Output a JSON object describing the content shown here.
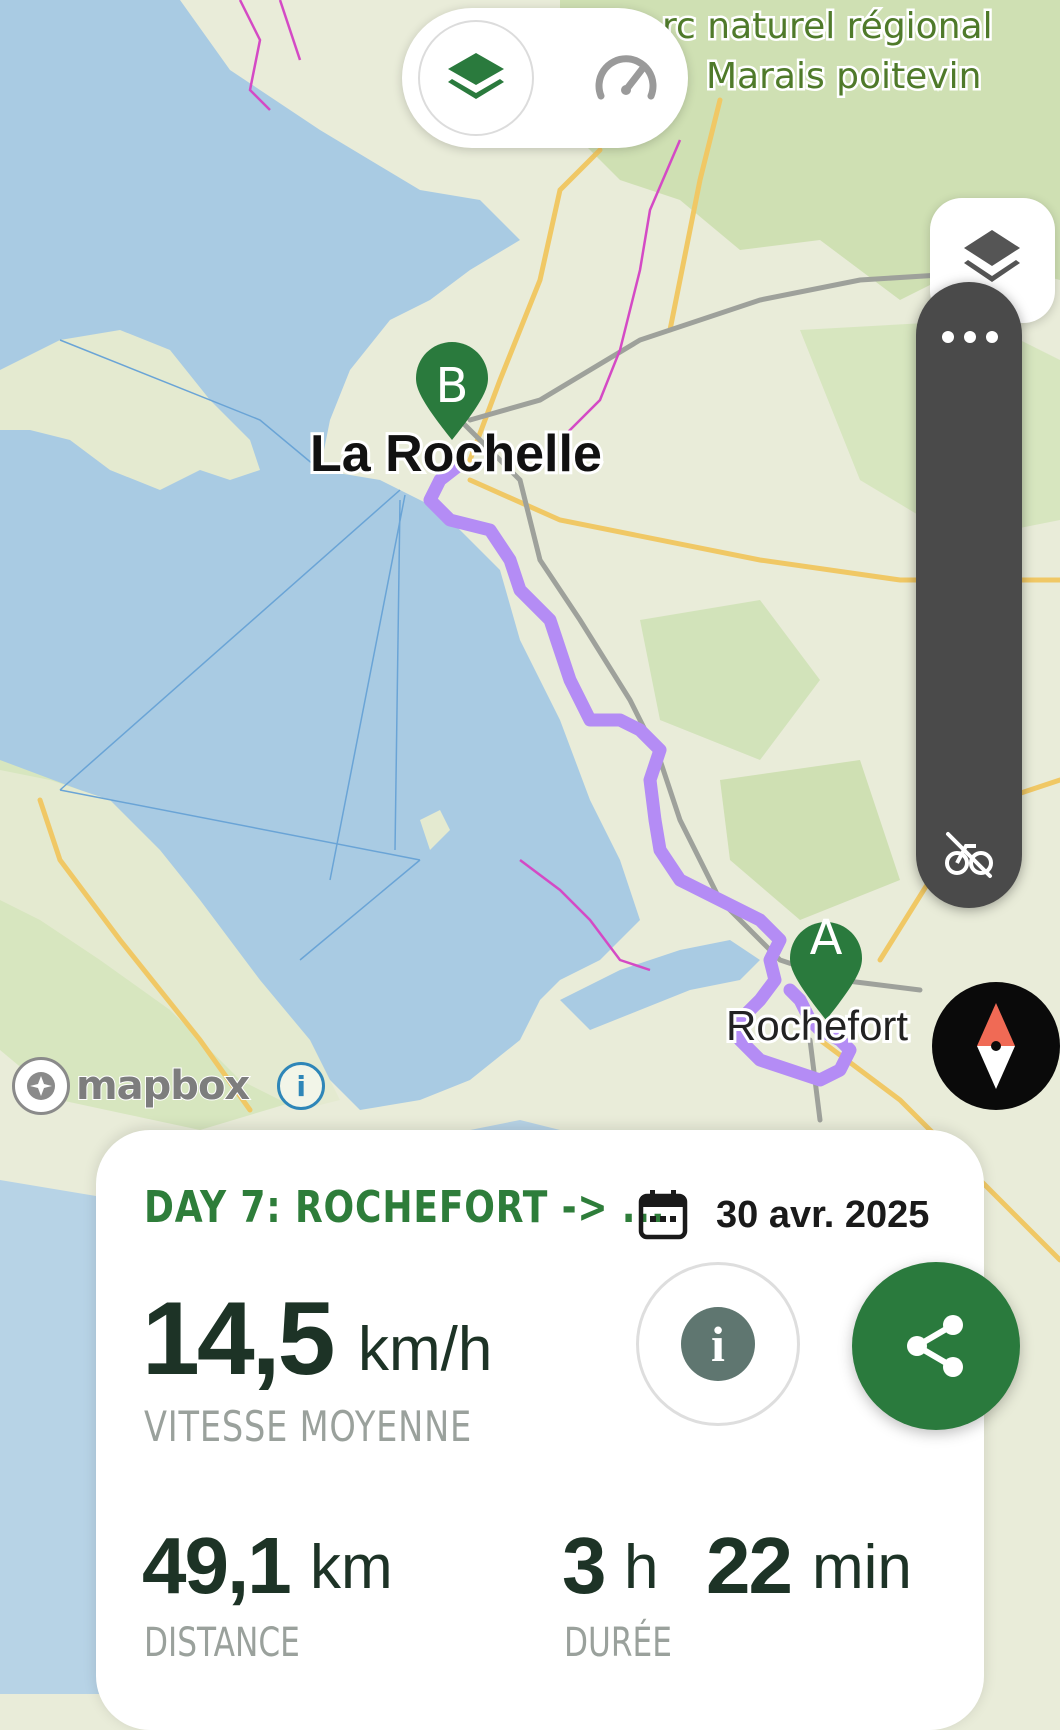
{
  "map": {
    "park_label_line1": "rc naturel régional",
    "park_label_line2": "Marais poitevin",
    "city_b_label": "La Rochelle",
    "city_a_label": "Rochefort",
    "marker_a": "A",
    "marker_b": "B",
    "attribution": "mapbox",
    "attribution_info": "i",
    "route_color": "#b48cf5",
    "marker_color": "#2a7a3d"
  },
  "controls": {
    "top_layer_icon": "layers-icon",
    "top_speed_icon": "speedometer-icon",
    "right_layers_icon": "layers-icon",
    "more_icon": "more-horizontal-icon",
    "bike_off_icon": "bike-off-icon",
    "compass_icon": "compass-icon"
  },
  "card": {
    "title": "DAY 7: ROCHEFORT -> ...",
    "date": "30 avr. 2025",
    "avg_speed_value": "14,5",
    "avg_speed_unit": "km/h",
    "avg_speed_label": "VITESSE MOYENNE",
    "distance_value": "49,1",
    "distance_unit": "km",
    "distance_label": "DISTANCE",
    "duration_hours_value": "3",
    "duration_hours_unit": "h",
    "duration_minutes_value": "22",
    "duration_minutes_unit": "min",
    "duration_label": "DURÉE",
    "info_glyph": "i"
  },
  "colors": {
    "accent_green": "#2a7a3d",
    "title_green": "#2e7d3a",
    "water": "#a9cbe3",
    "land": "#e9ecd9"
  }
}
